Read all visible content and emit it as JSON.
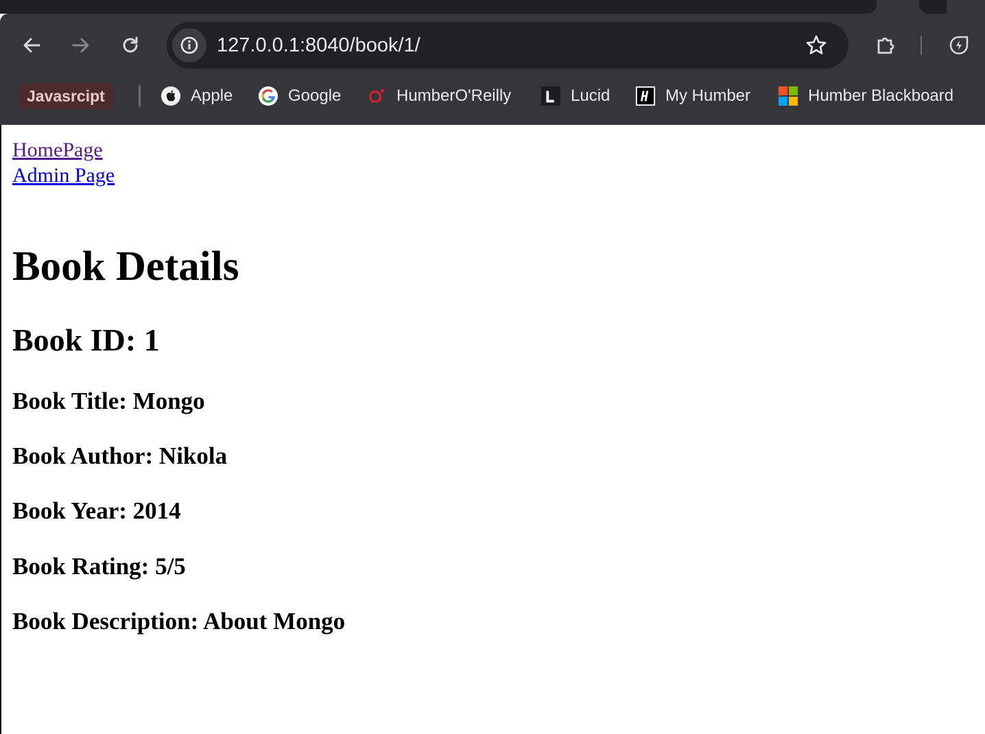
{
  "browser": {
    "url": "127.0.0.1:8040/book/1/",
    "bookmarks_folder": "Javasrcipt",
    "bookmarks": [
      {
        "label": "Apple",
        "icon": "apple-icon"
      },
      {
        "label": "Google",
        "icon": "google-icon"
      },
      {
        "label": "HumberO'Reilly",
        "icon": "oreilly-icon"
      },
      {
        "label": "Lucid",
        "icon": "lucid-icon"
      },
      {
        "label": "My Humber",
        "icon": "my-humber-icon"
      },
      {
        "label": "Humber Blackboard",
        "icon": "microsoft-icon"
      }
    ]
  },
  "page": {
    "nav": {
      "home_link": "HomePage",
      "admin_link": "Admin Page"
    },
    "heading": "Book Details",
    "book_id": "Book ID: 1",
    "title": "Book Title: Mongo",
    "author": "Book Author: Nikola",
    "year": "Book Year: 2014",
    "rating": "Book Rating: 5/5",
    "description": "Book Description: About Mongo"
  }
}
